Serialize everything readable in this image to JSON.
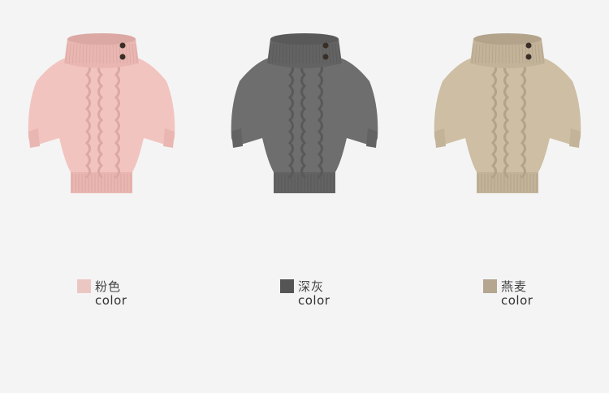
{
  "colors": [
    {
      "name_cn": "粉色",
      "name_en": "color",
      "swatch": "#ebc7c3",
      "garment": "#f2c4c0",
      "shade": "#dca8a4",
      "rib": "#e9b6b1"
    },
    {
      "name_cn": "深灰",
      "name_en": "color",
      "swatch": "#555555",
      "garment": "#6e6e6e",
      "shade": "#595959",
      "rib": "#636363"
    },
    {
      "name_cn": "燕麦",
      "name_en": "color",
      "swatch": "#b5a690",
      "garment": "#cdbea4",
      "shade": "#b3a38b",
      "rib": "#c2b399"
    }
  ]
}
